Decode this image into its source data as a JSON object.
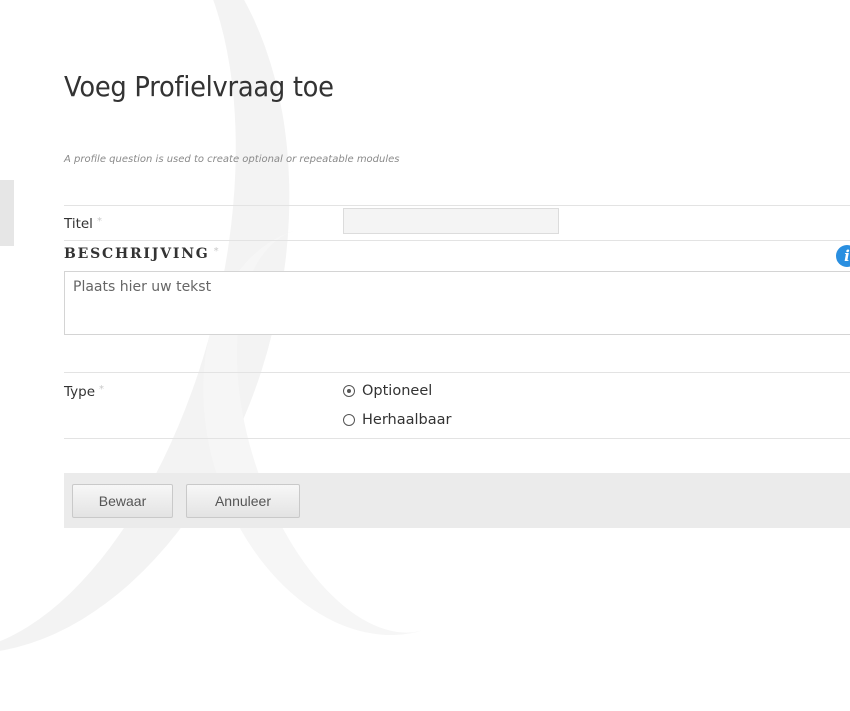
{
  "page": {
    "title": "Voeg Profielvraag toe",
    "subtitle": "A profile question is used to create optional or repeatable modules"
  },
  "form": {
    "titel_label": "Titel",
    "titel_value": "",
    "required_marker": "*",
    "beschrijving_heading": "BESCHRIJVING",
    "info_icon": "info-icon",
    "beschrijving_placeholder": "Plaats hier uw tekst",
    "type_label": "Type",
    "type_options": [
      {
        "label": "Optioneel",
        "checked": true
      },
      {
        "label": "Herhaalbaar",
        "checked": false
      }
    ]
  },
  "buttons": {
    "save_label": "Bewaar",
    "cancel_label": "Annuleer"
  },
  "colors": {
    "info_icon": "#2a8fe0",
    "button_bar": "#ebebeb"
  }
}
